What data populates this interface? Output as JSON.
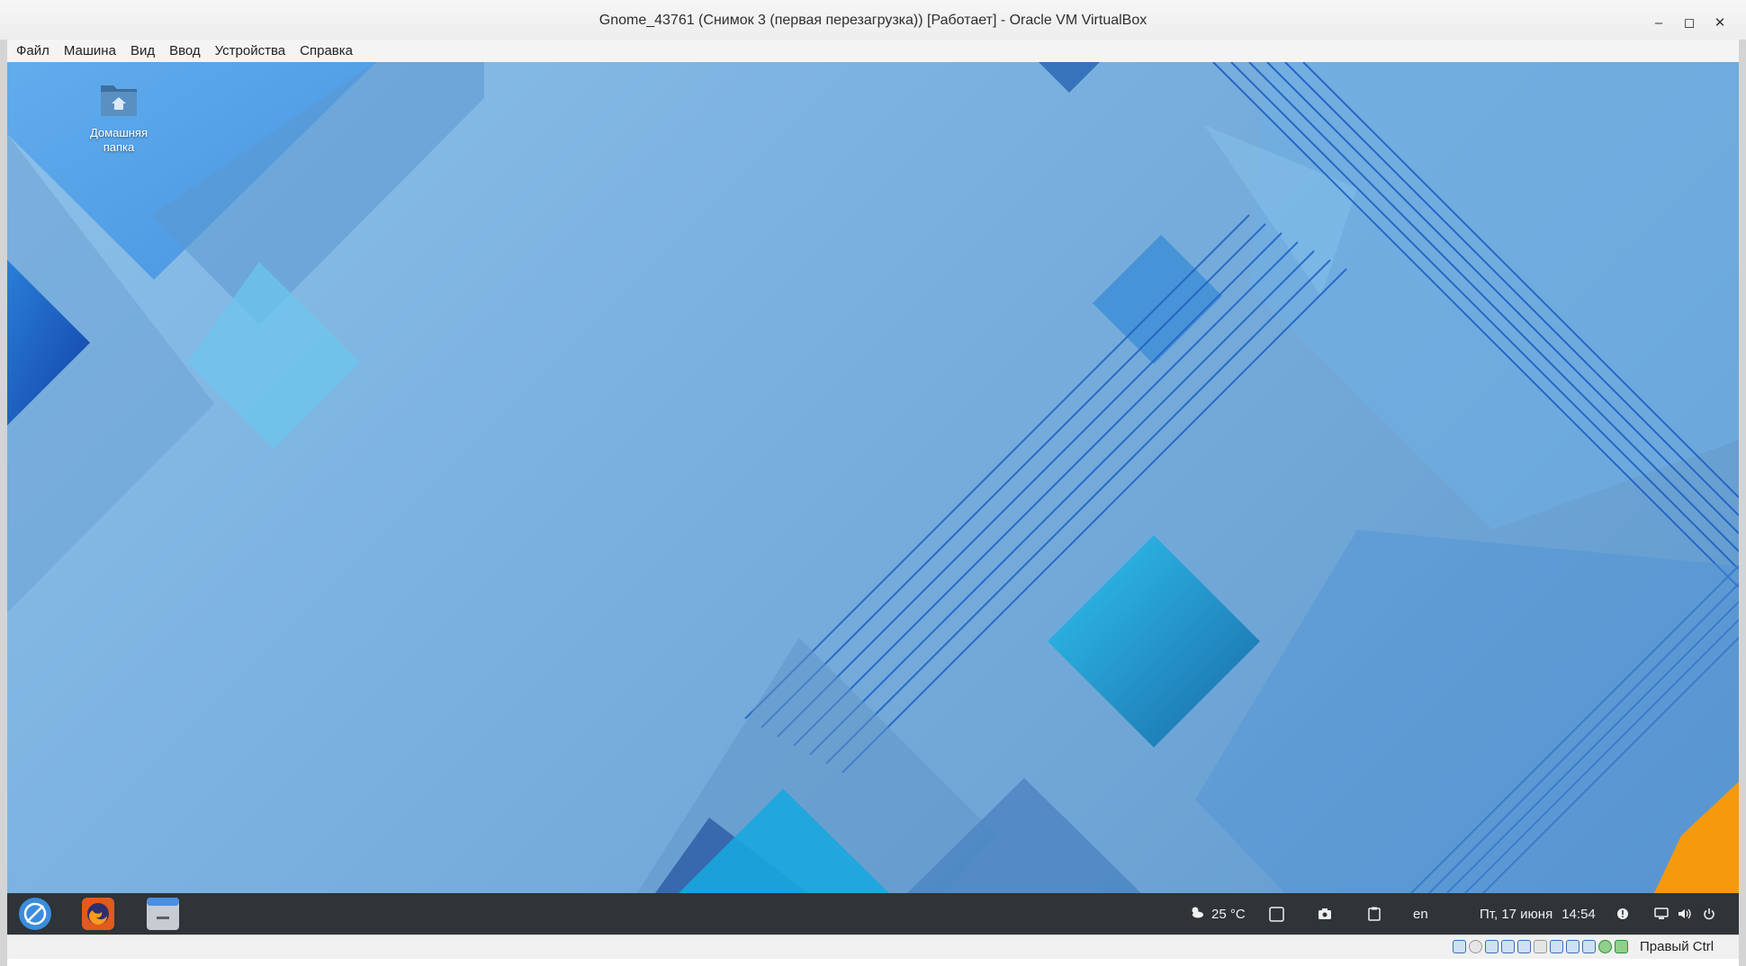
{
  "window": {
    "title": "Gnome_43761 (Снимок 3 (первая перезагрузка)) [Работает] - Oracle VM VirtualBox",
    "buttons": {
      "minimize": "–",
      "maximize": "◻",
      "close": "✕"
    }
  },
  "menu": {
    "items": [
      {
        "label": "Файл"
      },
      {
        "label": "Машина"
      },
      {
        "label": "Вид"
      },
      {
        "label": "Ввод"
      },
      {
        "label": "Устройства"
      },
      {
        "label": "Справка"
      }
    ]
  },
  "desktop": {
    "icons": [
      {
        "label_line1": "Домашняя",
        "label_line2": "папка",
        "icon": "home-folder-icon"
      }
    ]
  },
  "panel": {
    "weather": "25 °C",
    "keyboard_layout": "en",
    "date": "Пт, 17 июня",
    "time": "14:54",
    "apps": [
      "menu-logo-icon",
      "firefox-icon",
      "files-icon"
    ]
  },
  "statusbar": {
    "host_key": "Правый Ctrl"
  },
  "colors": {
    "panel_bg": "#2e3438",
    "desktop_accent": "#1e5fc4",
    "orange_corner": "#f59a0c"
  }
}
